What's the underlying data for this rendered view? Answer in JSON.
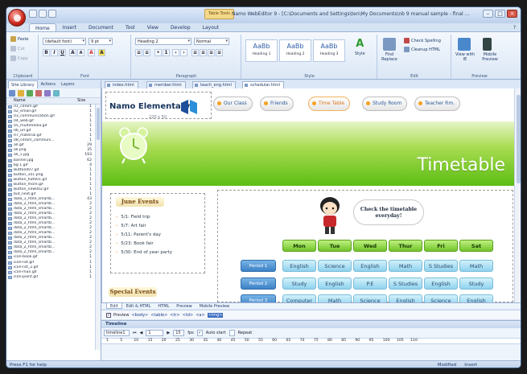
{
  "window": {
    "title": "Namo WebEditor 9 - [C:\\Documents and Settings\\ten\\My Documents\\nb 9 manual sample - final ...",
    "context_tab": "Table Tools",
    "tabs": [
      "Home",
      "Insert",
      "Document",
      "Tool",
      "View",
      "Develop",
      "Layout"
    ],
    "active_tab": "Home",
    "help": "?"
  },
  "ribbon": {
    "clipboard": {
      "label": "Clipboard",
      "paste": "Paste",
      "cut": "Cut",
      "copy": "Copy"
    },
    "font": {
      "label": "Font",
      "family": "(default font)",
      "size": "9 pt"
    },
    "paragraph": {
      "label": "Paragraph",
      "style": "Heading 2",
      "normal": "Normal"
    },
    "style": {
      "label": "Style",
      "boxes": [
        {
          "sample": "AaBb",
          "name": "Heading 1"
        },
        {
          "sample": "AaBb",
          "name": "Heading 2"
        },
        {
          "sample": "AaBb",
          "name": "Heading 3"
        }
      ],
      "style_btn": "Style"
    },
    "edit": {
      "label": "Edit",
      "find_replace": "Find Replace",
      "check_spelling": "Check Spelling",
      "cleanup": "Cleanup HTML"
    },
    "preview": {
      "label": "Preview",
      "view_with": "View with IE",
      "mobile": "Mobile Preview"
    }
  },
  "left_panel": {
    "tabs": [
      "Site Library",
      "Actions",
      "Layers"
    ],
    "columns": [
      "Name",
      "Size"
    ],
    "files": [
      {
        "name": "01_cdrom.gif",
        "size": "1"
      },
      {
        "name": "02_email.gif",
        "size": "1"
      },
      {
        "name": "03_communication.gif",
        "size": "1"
      },
      {
        "name": "04_web.gif",
        "size": "1"
      },
      {
        "name": "05_multimedia.gif",
        "size": "1"
      },
      {
        "name": "06_url.gif",
        "size": "1"
      },
      {
        "name": "07_material.gif",
        "size": "1"
      },
      {
        "name": "08_cdrom_communi...",
        "size": "1"
      },
      {
        "name": "all.gif",
        "size": "29"
      },
      {
        "name": "all.png",
        "size": "35"
      },
      {
        "name": "all_1.jpg",
        "size": "193"
      },
      {
        "name": "banner.jpg",
        "size": "62"
      },
      {
        "name": "bg 1.gif",
        "size": "4"
      },
      {
        "name": "Button007.gif",
        "size": "1"
      },
      {
        "name": "button_101.png",
        "size": "1"
      },
      {
        "name": "Button_hot001.gif",
        "size": "1"
      },
      {
        "name": "Button_more.gif",
        "size": "1"
      },
      {
        "name": "Button_new002.gif",
        "size": "1"
      },
      {
        "name": "but_next.gif",
        "size": "1"
      },
      {
        "name": "data_1_html_smartb...",
        "size": "43"
      },
      {
        "name": "data_2_html_smartb...",
        "size": "2"
      },
      {
        "name": "data_2_html_smartb...",
        "size": "2"
      },
      {
        "name": "data_2_html_smartb...",
        "size": "2"
      },
      {
        "name": "data_2_html_smartb...",
        "size": "2"
      },
      {
        "name": "data_2_html_smartb...",
        "size": "2"
      },
      {
        "name": "data_2_html_smartb...",
        "size": "2"
      },
      {
        "name": "data_2_html_smartb...",
        "size": "2"
      },
      {
        "name": "data_2_html_smartb...",
        "size": "2"
      },
      {
        "name": "data_2_html_smartb...",
        "size": "2"
      },
      {
        "name": "data_2_html_smartb...",
        "size": "2"
      },
      {
        "name": "data_2_html_smartb...",
        "size": "2"
      },
      {
        "name": "icon-book.gif",
        "size": "1"
      },
      {
        "name": "icon-list.gif",
        "size": "1"
      },
      {
        "name": "icon-list_2.gif",
        "size": "1"
      },
      {
        "name": "icon-man.gif",
        "size": "1"
      },
      {
        "name": "icon-point.gif",
        "size": "1"
      }
    ]
  },
  "doc_tabs": [
    "index.html",
    "member.html",
    "teach_eng.html",
    "schedular.html"
  ],
  "active_doc": "schedular.html",
  "page": {
    "logo": "Namo Elementary",
    "logo_size": "220 x 50",
    "nav": [
      "Our Class",
      "Friends",
      "Time Table",
      "Study Room",
      "Teacher Rm."
    ],
    "active_nav": "Time Table",
    "banner_title": "Timetable",
    "events_title": "June Events",
    "events": [
      "5/1: Field trip",
      "5/7: Art fair",
      "5/11: Parent's day",
      "5/23: Book fair",
      "5/30: End of year party"
    ],
    "special_title": "Special Events",
    "bubble": [
      "Check the timetable",
      "everyday!"
    ],
    "timetable": {
      "days": [
        "Mon",
        "Tue",
        "Wed",
        "Thur",
        "Fri",
        "Sat"
      ],
      "rows": [
        {
          "period": "Period 1",
          "cells": [
            "English",
            "Science",
            "English",
            "Math",
            "S Studies",
            "Math"
          ]
        },
        {
          "period": "Period 2",
          "cells": [
            "Study",
            "English",
            "P.E",
            "S Studies",
            "English",
            "Study"
          ]
        },
        {
          "period": "Period 3",
          "cells": [
            "Computer",
            "Math",
            "Science",
            "English",
            "Science",
            "English"
          ]
        }
      ]
    }
  },
  "view_tabs": [
    "Edit",
    "Edit & HTML",
    "HTML",
    "Preview",
    "Mobile Preview"
  ],
  "active_view": "Edit",
  "tagbar": {
    "preview_label": "Preview",
    "tags": [
      "<body>",
      "<table>",
      "<tr>",
      "<td>",
      "<a>",
      "<img>"
    ],
    "selected_tag": "<img>"
  },
  "timeline": {
    "title": "Timeline",
    "name": "timeline1",
    "frame": "1",
    "fps_value": "15",
    "fps_label": "fps",
    "autostart": "Auto start",
    "repeat": "Repeat",
    "ruler": [
      "1",
      "5",
      "10",
      "15",
      "20",
      "25",
      "30",
      "35",
      "40",
      "45",
      "50",
      "55",
      "60",
      "65",
      "70",
      "75",
      "80",
      "85",
      "90",
      "95",
      "100",
      "105",
      "110"
    ]
  },
  "status": {
    "left": "Press F1 for help",
    "modified": "Modified",
    "insert": "Insert"
  }
}
